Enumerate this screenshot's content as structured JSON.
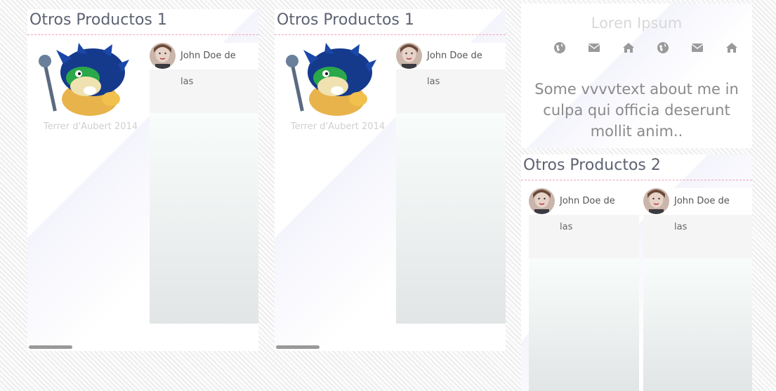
{
  "colors": {
    "title": "#5e6373",
    "divider": "#f2a0b4",
    "caption": "#d0d0d0",
    "author": "#555555",
    "about_text": "#8a8a8a"
  },
  "panels": [
    {
      "title": "Otros Productos 1",
      "product": {
        "image": "koopa-character-image",
        "caption": "Terrer d'Aubert 2014"
      },
      "comment": {
        "avatar": "woman-portrait-avatar",
        "author": "John Doe de",
        "text": "las"
      }
    },
    {
      "title": "Otros Productos 1",
      "product": {
        "image": "koopa-character-image",
        "caption": "Terrer d'Aubert 2014"
      },
      "comment": {
        "avatar": "woman-portrait-avatar",
        "author": "John Doe de",
        "text": "las"
      }
    }
  ],
  "about": {
    "title": "Loren Ipsum",
    "icons": [
      "globe-icon",
      "envelope-icon",
      "home-icon",
      "globe-icon",
      "envelope-icon",
      "home-icon"
    ],
    "text": "Some vvvvtext about me in culpa qui officia deserunt mollit anim.."
  },
  "products2": {
    "title": "Otros Productos 2",
    "comments": [
      {
        "avatar": "woman-portrait-avatar",
        "author": "John Doe de",
        "text": "las"
      },
      {
        "avatar": "woman-portrait-avatar",
        "author": "John Doe de",
        "text": "las"
      }
    ]
  }
}
